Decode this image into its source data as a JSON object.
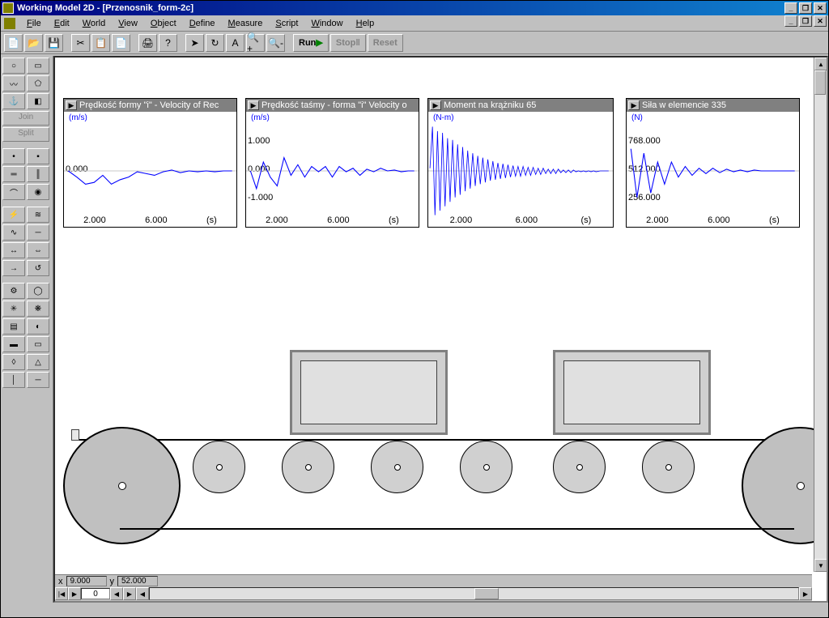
{
  "app": {
    "title": "Working Model 2D - [Przenosnik_form-2c]"
  },
  "menu": {
    "items": [
      "File",
      "Edit",
      "World",
      "View",
      "Object",
      "Define",
      "Measure",
      "Script",
      "Window",
      "Help"
    ]
  },
  "toolbar": {
    "run": "Run",
    "stop": "Stop",
    "reset": "Reset"
  },
  "side": {
    "join": "Join",
    "split": "Split"
  },
  "status": {
    "x_label": "x",
    "x_val": "9.000",
    "y_label": "y",
    "y_val": "52.000",
    "frame": "0"
  },
  "panels": [
    {
      "title": "Prędkość formy \"i\"  -  Velocity of Rec",
      "unit": "(m/s)",
      "yticks": [
        "0.000"
      ],
      "xticks": [
        "2.000",
        "6.000"
      ],
      "xunit": "(s)"
    },
    {
      "title": "Prędkość taśmy - forma \"i\"    Velocity o",
      "unit": "(m/s)",
      "yticks": [
        "1.000",
        "0.000",
        "-1.000"
      ],
      "xticks": [
        "2.000",
        "6.000"
      ],
      "xunit": "(s)"
    },
    {
      "title": "Moment na krążniku 65",
      "unit": "(N-m)",
      "yticks": [],
      "xticks": [
        "2.000",
        "6.000"
      ],
      "xunit": "(s)"
    },
    {
      "title": "Siła w elemencie 335",
      "unit": "(N)",
      "yticks": [
        "768.000",
        "512.000",
        "256.000"
      ],
      "xticks": [
        "2.000",
        "6.000"
      ],
      "xunit": "(s)"
    }
  ],
  "chart_data": [
    {
      "type": "line",
      "title": "Prędkość formy \"i\" - Velocity of Rec",
      "xlabel": "(s)",
      "ylabel": "(m/s)",
      "ylim": [
        -1.5,
        1.5
      ],
      "x": [
        0,
        0.5,
        1,
        1.5,
        2,
        2.5,
        3,
        3.5,
        4,
        4.5,
        5,
        5.5,
        6,
        6.5,
        7,
        7.5,
        8
      ],
      "values": [
        0,
        -0.2,
        -0.3,
        -0.1,
        -0.3,
        -0.2,
        0,
        0,
        -0.1,
        0,
        0,
        0,
        -0.05,
        0,
        0,
        0,
        0
      ]
    },
    {
      "type": "line",
      "title": "Prędkość taśmy - forma \"i\" Velocity o",
      "xlabel": "(s)",
      "ylabel": "(m/s)",
      "ylim": [
        -1.5,
        1.5
      ],
      "x": [
        0,
        0.5,
        1,
        1.5,
        2,
        2.5,
        3,
        3.5,
        4,
        4.5,
        5,
        5.5,
        6,
        6.5,
        7,
        7.5,
        8
      ],
      "values": [
        0,
        -0.3,
        0.1,
        -0.1,
        -0.3,
        0.2,
        -0.1,
        0.1,
        -0.1,
        0.1,
        0,
        0.1,
        -0.1,
        0.1,
        0,
        0.05,
        0
      ]
    },
    {
      "type": "line",
      "title": "Moment na krążniku 65",
      "xlabel": "(s)",
      "ylabel": "(N-m)",
      "ylim": [
        -80,
        80
      ],
      "x": [
        0,
        0.5,
        1,
        1.5,
        2,
        2.5,
        3,
        3.5,
        4,
        4.5,
        5,
        5.5,
        6,
        6.5,
        7,
        7.5,
        8
      ],
      "values": [
        5,
        60,
        -55,
        50,
        -45,
        40,
        -30,
        25,
        -20,
        18,
        -12,
        10,
        -8,
        6,
        -5,
        4,
        -3
      ]
    },
    {
      "type": "line",
      "title": "Siła w elemencie 335",
      "xlabel": "(s)",
      "ylabel": "(N)",
      "ylim": [
        0,
        800
      ],
      "x": [
        0,
        0.5,
        1,
        1.5,
        2,
        2.5,
        3,
        3.5,
        4,
        4.5,
        5,
        5.5,
        6,
        6.5,
        7,
        7.5,
        8
      ],
      "values": [
        520,
        260,
        500,
        280,
        420,
        320,
        430,
        360,
        400,
        370,
        390,
        380,
        395,
        385,
        390,
        388,
        390
      ]
    }
  ]
}
